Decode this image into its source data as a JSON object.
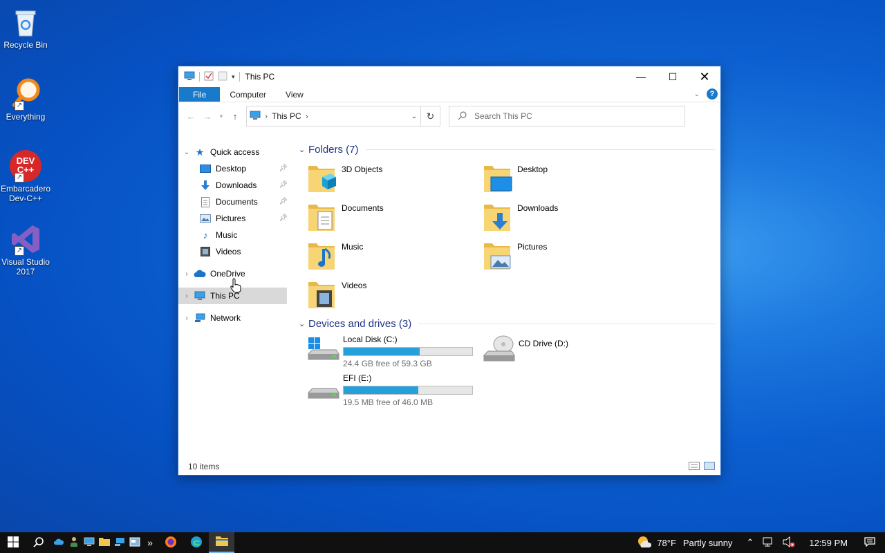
{
  "desktop": {
    "icons": [
      {
        "label": "Recycle Bin"
      },
      {
        "label": "Everything"
      },
      {
        "label": "Embarcadero Dev-C++"
      },
      {
        "label": "Visual Studio 2017"
      }
    ],
    "devcpp_logo_text": "DEV C++"
  },
  "window": {
    "title": "This PC",
    "ribbon_tabs": [
      "File",
      "Computer",
      "View"
    ],
    "help_glyph": "?",
    "address_crumb": "This PC",
    "search_placeholder": "Search This PC",
    "status_items": "10 items"
  },
  "nav": {
    "quick_access": "Quick access",
    "quick_items": [
      {
        "label": "Desktop",
        "pinned": true
      },
      {
        "label": "Downloads",
        "pinned": true
      },
      {
        "label": "Documents",
        "pinned": true
      },
      {
        "label": "Pictures",
        "pinned": true
      },
      {
        "label": "Music",
        "pinned": false
      },
      {
        "label": "Videos",
        "pinned": false
      }
    ],
    "onedrive": "OneDrive",
    "this_pc": "This PC",
    "network": "Network"
  },
  "content": {
    "folders_header": "Folders (7)",
    "folders": [
      "3D Objects",
      "Desktop",
      "Documents",
      "Downloads",
      "Music",
      "Pictures",
      "Videos"
    ],
    "devices_header": "Devices and drives (3)",
    "drives": [
      {
        "name": "Local Disk (C:)",
        "free_text": "24.4 GB free of 59.3 GB",
        "used_fraction": 0.59
      },
      {
        "name": "CD Drive (D:)"
      },
      {
        "name": "EFI (E:)",
        "free_text": "19.5 MB free of 46.0 MB",
        "used_fraction": 0.58
      }
    ]
  },
  "taskbar": {
    "weather_temp": "78°F",
    "weather_text": "Partly sunny",
    "time": "12:59 PM",
    "overflow_glyph": "»"
  },
  "colors": {
    "accent": "#1979ca",
    "drive_fill": "#26a0da",
    "group_header": "#1e3287"
  }
}
